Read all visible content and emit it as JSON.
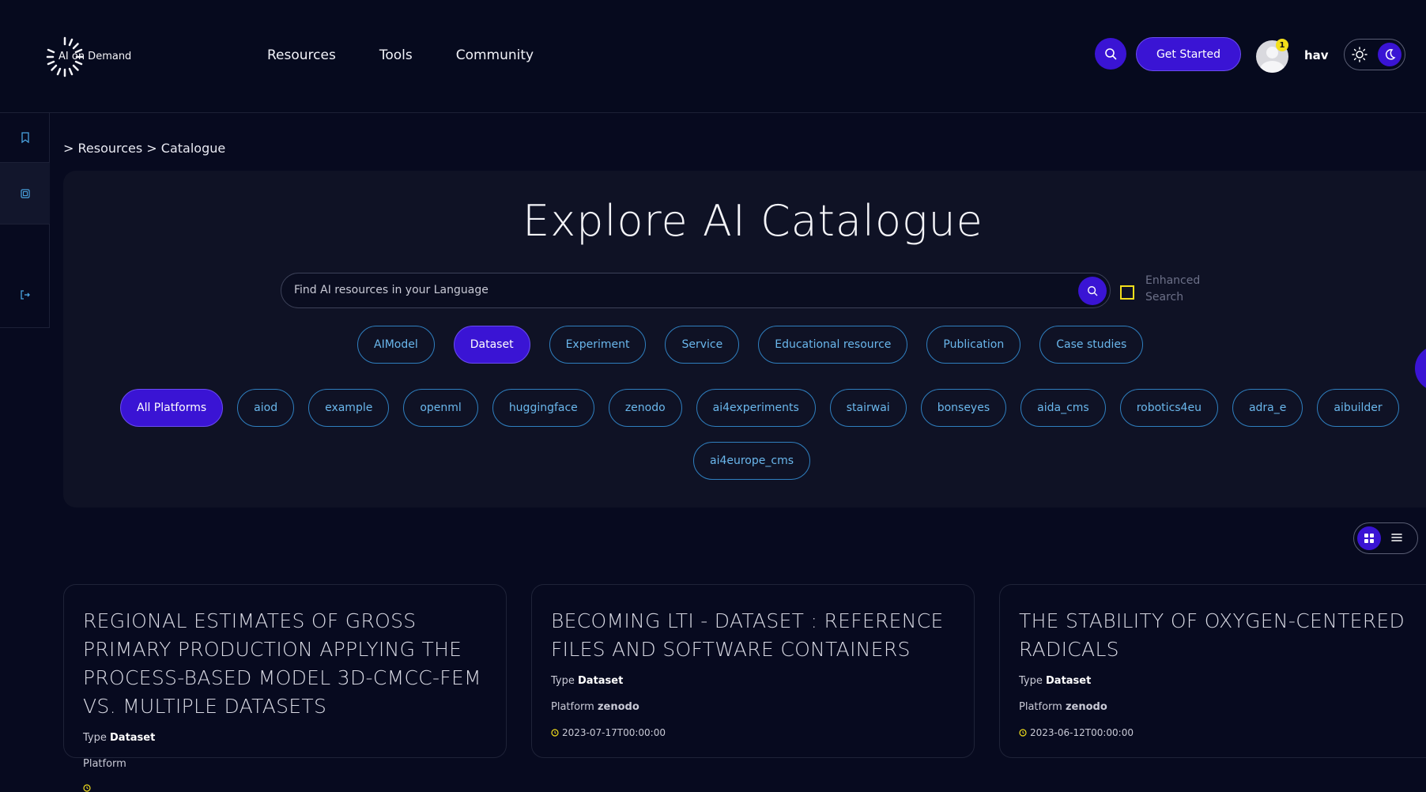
{
  "logo": {
    "text": "AI on Demand"
  },
  "nav": {
    "items": [
      "Resources",
      "Tools",
      "Community"
    ]
  },
  "header": {
    "get_started": "Get Started",
    "notification_count": "1",
    "username": "hav"
  },
  "breadcrumb": "> Resources > Catalogue",
  "hero": {
    "title": "Explore AI Catalogue",
    "search_placeholder": "Find AI resources in your Language",
    "enhanced_search_label": "Enhanced Search"
  },
  "resource_types": [
    {
      "label": "AIModel",
      "active": false
    },
    {
      "label": "Dataset",
      "active": true
    },
    {
      "label": "Experiment",
      "active": false
    },
    {
      "label": "Service",
      "active": false
    },
    {
      "label": "Educational resource",
      "active": false
    },
    {
      "label": "Publication",
      "active": false
    },
    {
      "label": "Case studies",
      "active": false
    }
  ],
  "platforms": [
    {
      "label": "All Platforms",
      "active": true
    },
    {
      "label": "aiod",
      "active": false
    },
    {
      "label": "example",
      "active": false
    },
    {
      "label": "openml",
      "active": false
    },
    {
      "label": "huggingface",
      "active": false
    },
    {
      "label": "zenodo",
      "active": false
    },
    {
      "label": "ai4experiments",
      "active": false
    },
    {
      "label": "stairwai",
      "active": false
    },
    {
      "label": "bonseyes",
      "active": false
    },
    {
      "label": "aida_cms",
      "active": false
    },
    {
      "label": "robotics4eu",
      "active": false
    },
    {
      "label": "adra_e",
      "active": false
    },
    {
      "label": "aibuilder",
      "active": false
    },
    {
      "label": "ai4europe_cms",
      "active": false
    }
  ],
  "cards": [
    {
      "title": "REGIONAL ESTIMATES OF GROSS PRIMARY PRODUCTION APPLYING THE PROCESS-BASED MODEL 3D-CMCC-FEM VS. MULTIPLE DATASETS",
      "type_label": "Type",
      "type_value": "Dataset",
      "platform_label": "Platform",
      "platform_value": "",
      "date": ""
    },
    {
      "title": "BECOMING LTI - DATASET : REFERENCE FILES AND SOFTWARE CONTAINERS",
      "type_label": "Type",
      "type_value": "Dataset",
      "platform_label": "Platform",
      "platform_value": "zenodo",
      "date": "2023-07-17T00:00:00"
    },
    {
      "title": "THE STABILITY OF OXYGEN-CENTERED RADICALS",
      "type_label": "Type",
      "type_value": "Dataset",
      "platform_label": "Platform",
      "platform_value": "zenodo",
      "date": "2023-06-12T00:00:00"
    }
  ],
  "colors": {
    "background": "#070a1f",
    "accent": "#3a14d4",
    "chip_border": "#2f7fbf",
    "chip_text": "#6ab7ec",
    "highlight": "#f3df1b"
  },
  "icons": [
    "logo-sunburst-icon",
    "search-icon",
    "bookmark-icon",
    "ai-chip-icon",
    "logout-icon",
    "sun-icon",
    "moon-icon",
    "grid-icon",
    "list-icon",
    "clock-icon"
  ]
}
